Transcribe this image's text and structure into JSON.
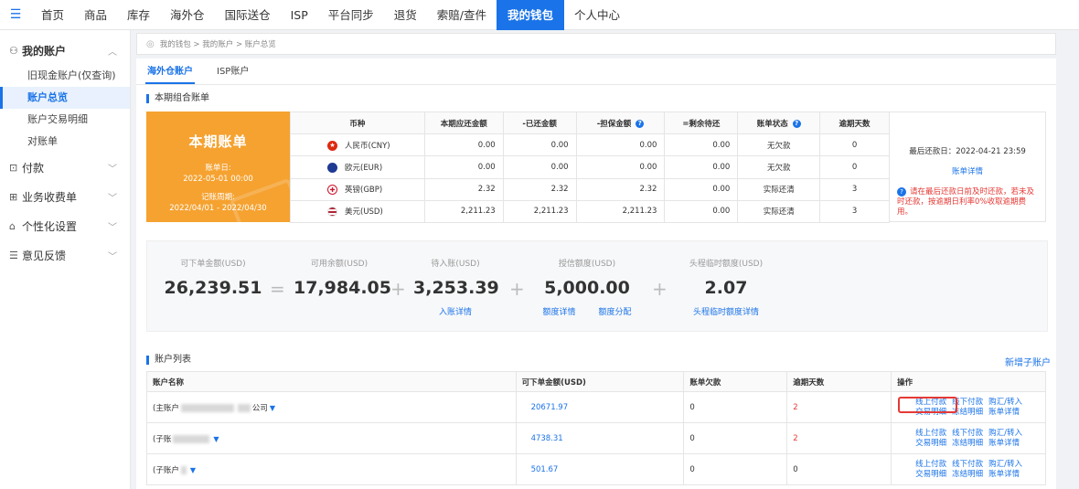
{
  "topnav": {
    "items": [
      "首页",
      "商品",
      "库存",
      "海外仓",
      "国际送仓",
      "ISP",
      "平台同步",
      "退货",
      "索赔/查件",
      "我的钱包",
      "个人中心"
    ],
    "active_index": 9
  },
  "sidebar": {
    "account_group": "我的账户",
    "account_items": [
      "旧现金账户(仅查询)",
      "账户总览",
      "账户交易明细",
      "对账单"
    ],
    "active_item": "账户总览",
    "other_groups": [
      "付款",
      "业务收费单",
      "个性化设置",
      "意见反馈"
    ]
  },
  "breadcrumb": "我的钱包 > 我的账户 > 账户总览",
  "tabs": [
    "海外仓账户",
    "ISP账户"
  ],
  "bill_section_title": "本期组合账单",
  "bill_card": {
    "title": "本期账单",
    "bill_date_label": "账单日:",
    "bill_date": "2022-05-01 00:00",
    "period_label": "记账周期:",
    "period": "2022/04/01 - 2022/04/30"
  },
  "bill_table": {
    "headers": [
      "币种",
      "本期应还金额",
      "-已还金额",
      "-担保金额",
      "=剩余待还",
      "账单状态",
      "逾期天数"
    ],
    "rows": [
      {
        "flag": "cny",
        "currency": "人民币(CNY)",
        "due": "0.00",
        "paid": "0.00",
        "guarantee": "0.00",
        "remaining": "0.00",
        "status": "无欠款",
        "overdue": "0"
      },
      {
        "flag": "eur",
        "currency": "欧元(EUR)",
        "due": "0.00",
        "paid": "0.00",
        "guarantee": "0.00",
        "remaining": "0.00",
        "status": "无欠款",
        "overdue": "0"
      },
      {
        "flag": "gbp",
        "currency": "英镑(GBP)",
        "due": "2.32",
        "paid": "2.32",
        "guarantee": "2.32",
        "remaining": "0.00",
        "status": "实际还清",
        "overdue": "3"
      },
      {
        "flag": "usd",
        "currency": "美元(USD)",
        "due": "2,211.23",
        "paid": "2,211.23",
        "guarantee": "2,211.23",
        "remaining": "0.00",
        "status": "实际还清",
        "overdue": "3"
      }
    ]
  },
  "bill_side": {
    "last_due": "最后还款日：2022-04-21 23:59",
    "detail_link": "账单详情",
    "warning": "请在最后还款日前及时还款，若未及时还款，按逾期日利率0%收取逾期费用。"
  },
  "summary": {
    "orderable_label": "可下单金额(USD)",
    "orderable": "26,239.51",
    "available_label": "可用余额(USD)",
    "available": "17,984.05",
    "pending_label": "待入账(USD)",
    "pending": "3,253.39",
    "pending_link": "入账详情",
    "credit_label": "授信额度(USD)",
    "credit": "5,000.00",
    "credit_link1": "额度详情",
    "credit_link2": "额度分配",
    "temp_label": "头程临时额度(USD)",
    "temp": "2.07",
    "temp_link": "头程临时额度详情",
    "op_eq": "=",
    "op_plus": "+"
  },
  "account_section_title": "账户列表",
  "new_sub_account": "新增子账户",
  "account_table": {
    "headers": [
      "账户名称",
      "可下单金额(USD)",
      "账单欠款",
      "逾期天数",
      "操作"
    ],
    "rows": [
      {
        "name_prefix": "(主账户",
        "name_suffix": "公司",
        "amount": "20671.97",
        "debt": "0",
        "overdue": "2",
        "overdue_red": true,
        "highlight": true
      },
      {
        "name_prefix": "(子账",
        "name_suffix": "",
        "amount": "4738.31",
        "debt": "0",
        "overdue": "2",
        "overdue_red": true,
        "highlight": false
      },
      {
        "name_prefix": "(子账户",
        "name_suffix": "",
        "amount": "501.67",
        "debt": "0",
        "overdue": "0",
        "overdue_red": false,
        "highlight": false
      }
    ],
    "ops_row1": [
      "线上付款",
      "线下付款",
      "购汇/转入"
    ],
    "ops_row2": [
      "交易明细",
      "冻结明细",
      "账单详情"
    ]
  }
}
